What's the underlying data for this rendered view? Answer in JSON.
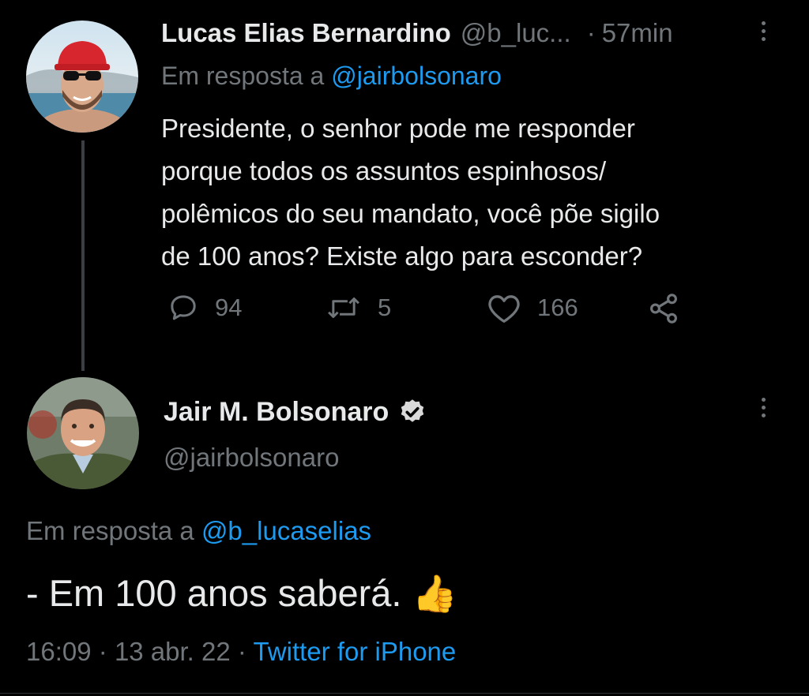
{
  "reply_tweet": {
    "author_name": "Lucas Elias Bernardino",
    "author_handle": "@b_luc...",
    "time": "57min",
    "in_reply_prefix": "Em resposta a",
    "in_reply_handle": "@jairbolsonaro",
    "text_lines": [
      "Presidente, o senhor pode me responder",
      "porque todos os assuntos espinhosos/",
      "polêmicos do seu mandato, você põe sigilo",
      "de 100 anos? Existe algo para esconder?"
    ],
    "replies": "94",
    "retweets": "5",
    "likes": "166"
  },
  "main_tweet": {
    "author_name": "Jair M. Bolsonaro",
    "author_handle": "@jairbolsonaro",
    "in_reply_prefix": "Em resposta a",
    "in_reply_handle": "@b_lucaselias",
    "text": "- Em 100 anos saberá.",
    "emoji": "👍",
    "time": "16:09",
    "date": "13 abr. 22",
    "source": "Twitter for iPhone"
  },
  "colors": {
    "background": "#000000",
    "text": "#e7e9ea",
    "muted": "#71767b",
    "link": "#1d9bf0"
  }
}
